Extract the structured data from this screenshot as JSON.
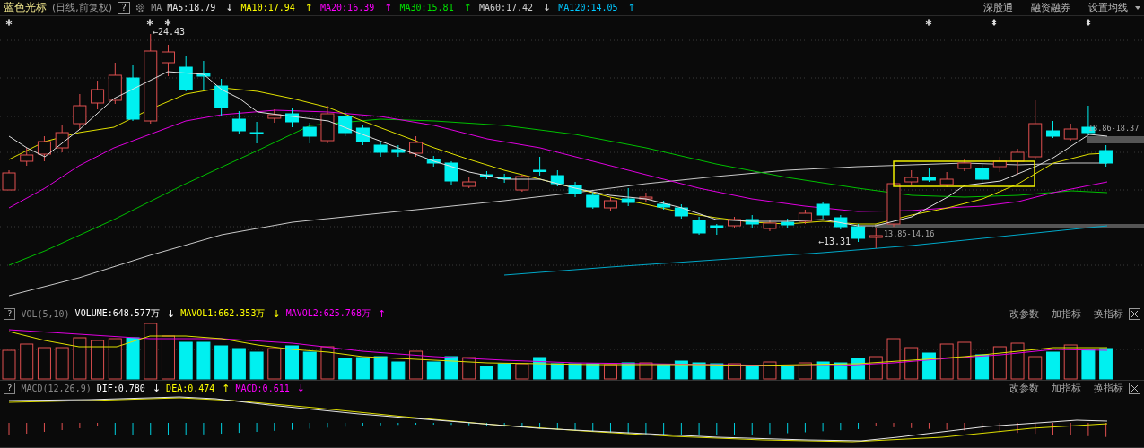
{
  "toolbar": {
    "title": "蓝色光标",
    "period": "(日线,前复权)",
    "help": "?",
    "indicator": "MA",
    "legends": [
      {
        "label": "MA5:18.79",
        "arrow": "↓",
        "color": "#e8e8e8"
      },
      {
        "label": "MA10:17.94",
        "arrow": "↑",
        "color": "#ffff00"
      },
      {
        "label": "MA20:16.39",
        "arrow": "↑",
        "color": "#ff00ff"
      },
      {
        "label": "MA30:15.81",
        "arrow": "↑",
        "color": "#00e000"
      },
      {
        "label": "MA60:17.42",
        "arrow": "↓",
        "color": "#d0d0d0"
      },
      {
        "label": "MA120:14.05",
        "arrow": "↑",
        "color": "#00c8ff"
      }
    ],
    "links": [
      "深股通",
      "融资融券",
      "设置均线"
    ]
  },
  "price_chart": {
    "annotations": [
      {
        "text": "←24.43",
        "kind": "extreme"
      },
      {
        "text": "←13.31",
        "kind": "extreme"
      },
      {
        "text": "13.85-14.16",
        "kind": "range"
      },
      {
        "text": "18.86-18.37",
        "kind": "range"
      }
    ]
  },
  "panels": [
    {
      "kind": "volume",
      "help": "?",
      "name": "VOL(5,10)",
      "legends": [
        {
          "label": "VOLUME:648.577万",
          "arrow": "↓",
          "color": "#ffffff"
        },
        {
          "label": "MAVOL1:662.353万",
          "arrow": "↓",
          "color": "#ffff00"
        },
        {
          "label": "MAVOL2:625.768万",
          "arrow": "↑",
          "color": "#ff00ff"
        }
      ],
      "actions": [
        "改参数",
        "加指标",
        "换指标"
      ]
    },
    {
      "kind": "macd",
      "help": "?",
      "name": "MACD(12,26,9)",
      "legends": [
        {
          "label": "DIF:0.780",
          "arrow": "↓",
          "color": "#ffffff"
        },
        {
          "label": "DEA:0.474",
          "arrow": "↑",
          "color": "#ffff00"
        },
        {
          "label": "MACD:0.611",
          "arrow": "↓",
          "color": "#ff00ff"
        }
      ],
      "actions": [
        "改参数",
        "加指标",
        "换指标"
      ]
    }
  ]
}
